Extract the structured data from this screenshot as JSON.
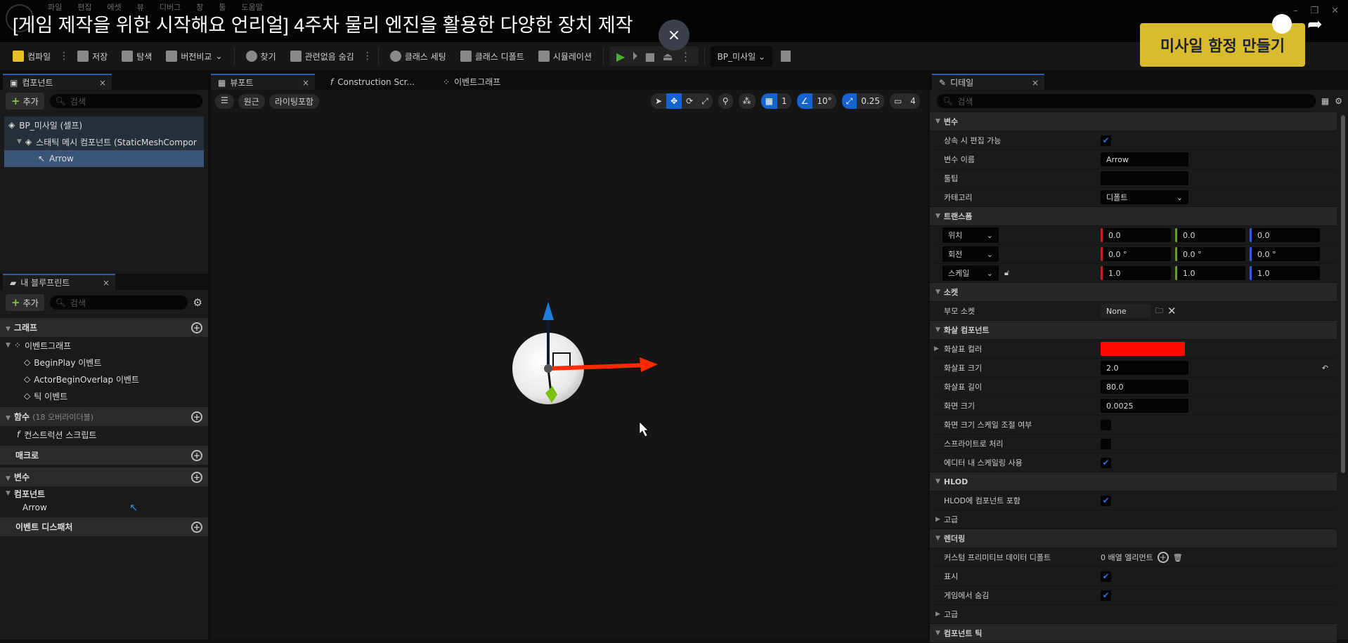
{
  "video_overlay": {
    "title": "[게임 제작을 위한 시작해요 언리얼] 4주차 물리 엔진을 활용한 다양한 장치 제작",
    "banner": "미사일 함정 만들기",
    "close_icon": "×",
    "banner_color": "#d9bb2e"
  },
  "menu": [
    "파일",
    "편집",
    "에셋",
    "뷰",
    "디버그",
    "창",
    "툴",
    "도움말"
  ],
  "toolbar": {
    "compile": "컴파일",
    "save": "저장",
    "browse": "탐색",
    "diff": "버전비교",
    "find": "찾기",
    "hide_unrelated": "관련없음 숨김",
    "class_settings": "클래스 세팅",
    "class_defaults": "클래스 디폴트",
    "simulation": "시뮬레이션",
    "blueprint_select": "BP_미사일"
  },
  "tabs": {
    "components": "컴포넌트",
    "viewport": "뷰포트",
    "construction": "Construction Scr...",
    "event_graph": "이벤트그래프",
    "details": "디테일",
    "my_blueprint": "내 블루프린트"
  },
  "components_panel": {
    "add": "추가",
    "search_placeholder": "검색",
    "tree": [
      "BP_미사일 (셀프)",
      "스태틱 메시 컴포넌트 (StaticMeshCompor",
      "Arrow"
    ],
    "selected": "Arrow"
  },
  "my_blueprint": {
    "add": "추가",
    "search_placeholder": "검색",
    "graph": "그래프",
    "event_graph": "이벤트그래프",
    "events": [
      "BeginPlay 이벤트",
      "ActorBeginOverlap 이벤트",
      "틱 이벤트"
    ],
    "functions": "함수",
    "functions_note": "(18 오버라이더블)",
    "construction_script": "컨스트럭션 스크립트",
    "macros": "매크로",
    "variables": "변수",
    "components": "컴포넌트",
    "component_var": "Arrow",
    "event_dispatchers": "이벤트 디스패처"
  },
  "viewport": {
    "menu": "☰",
    "perspective": "원근",
    "lighting": "라이팅포함",
    "grid_snap": "1",
    "rotation_snap": "10°",
    "scale_snap": "0.25",
    "camera_speed": "4"
  },
  "details": {
    "search_placeholder": "검색",
    "variable": {
      "header": "변수",
      "editable_label": "상속 시 편집 가능",
      "editable": true,
      "name_label": "변수 이름",
      "name": "Arrow",
      "tooltip_label": "툴팁",
      "tooltip": "",
      "category_label": "카테고리",
      "category": "디폴트"
    },
    "transform": {
      "header": "트랜스폼",
      "location_label": "위치",
      "location": [
        "0.0",
        "0.0",
        "0.0"
      ],
      "rotation_label": "회전",
      "rotation": [
        "0.0 °",
        "0.0 °",
        "0.0 °"
      ],
      "scale_label": "스케일",
      "scale": [
        "1.0",
        "1.0",
        "1.0"
      ]
    },
    "sockets": {
      "header": "소켓",
      "parent_label": "부모 소켓",
      "parent": "None"
    },
    "arrow": {
      "header": "화살 컴포넌트",
      "color_label": "화살표 컬러",
      "color": "#ff0a00",
      "size_label": "화살표 크기",
      "size": "2.0",
      "length_label": "화살표 길이",
      "length": "80.0",
      "screen_size_label": "화면 크기",
      "screen_size": "0.0025",
      "screen_scale_label": "화면 크기 스케일 조절 여부",
      "screen_scale": false,
      "sprite_label": "스프라이트로 처리",
      "sprite": false,
      "editor_scale_label": "에디터 내 스케일링 사용",
      "editor_scale": true
    },
    "hlod": {
      "header": "HLOD",
      "include_label": "HLOD에 컴포넌트 포함",
      "include": true,
      "advanced": "고급"
    },
    "rendering": {
      "header": "렌더링",
      "cpd_label": "커스텀 프리미티브 데이터 디폴트",
      "cpd": "0 배열 엘리먼트",
      "visible_label": "표시",
      "visible": true,
      "hidden_label": "게임에서 숨김",
      "hidden": true,
      "advanced": "고급"
    },
    "component_tick": "컴포넌트 틱"
  }
}
